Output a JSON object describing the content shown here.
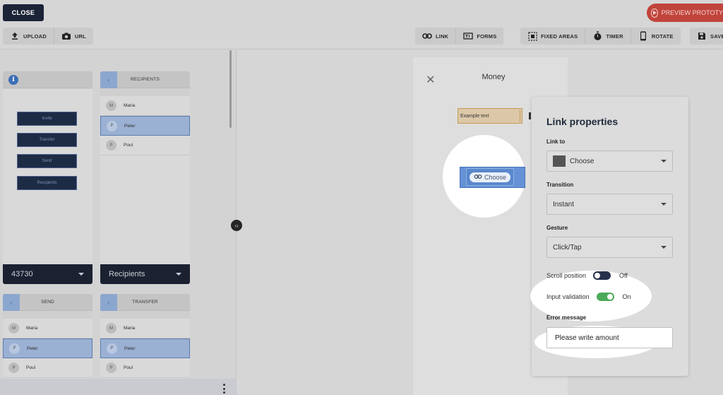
{
  "topbar": {
    "close_label": "CLOSE",
    "preview_label": "PREVIEW PROTOTYPE"
  },
  "toolbar": {
    "upload": "UPLOAD",
    "url": "URL",
    "link": "LINK",
    "forms": "FORMS",
    "fixed_areas": "FIXED AREAS",
    "timer": "TIMER",
    "rotate": "ROTATE",
    "save": "SAVE"
  },
  "screens": {
    "first": {
      "info_icon": "i",
      "buttons": [
        "Invite",
        "Transfer",
        "Send",
        "Recipients"
      ],
      "footer": "43730"
    },
    "recipients": {
      "title": "RECIPIENTS",
      "rows": [
        {
          "initial": "M",
          "name": "Maria",
          "selected": false
        },
        {
          "initial": "P",
          "name": "Peter",
          "selected": true
        },
        {
          "initial": "P",
          "name": "Poul",
          "selected": false
        }
      ],
      "footer": "Recipients"
    },
    "send": {
      "title": "SEND",
      "rows": [
        {
          "initial": "M",
          "name": "Maria"
        },
        {
          "initial": "P",
          "name": "Peter"
        },
        {
          "initial": "P",
          "name": "Poul"
        }
      ]
    },
    "transfer": {
      "title": "TRANSFER",
      "rows": [
        {
          "initial": "M",
          "name": "Maria"
        },
        {
          "initial": "P",
          "name": "Peter"
        },
        {
          "initial": "P",
          "name": "Poul"
        }
      ]
    }
  },
  "canvas": {
    "phone_title": "Money",
    "example_text": "Example text",
    "choose_button": "Choose"
  },
  "props": {
    "title": "Link properties",
    "link_to_label": "Link to",
    "link_to_value": "Choose",
    "transition_label": "Transition",
    "transition_value": "Instant",
    "gesture_label": "Gesture",
    "gesture_value": "Click/Tap",
    "scroll_label": "Scroll position",
    "scroll_state": "Off",
    "validation_label": "Input validation",
    "validation_state": "On",
    "error_label": "Error message",
    "error_value": "Please write amount"
  },
  "colors": {
    "accent": "#1b2437",
    "preview": "#c0443c",
    "toggle_on": "#4caa5a",
    "selection": "#6592d6"
  }
}
